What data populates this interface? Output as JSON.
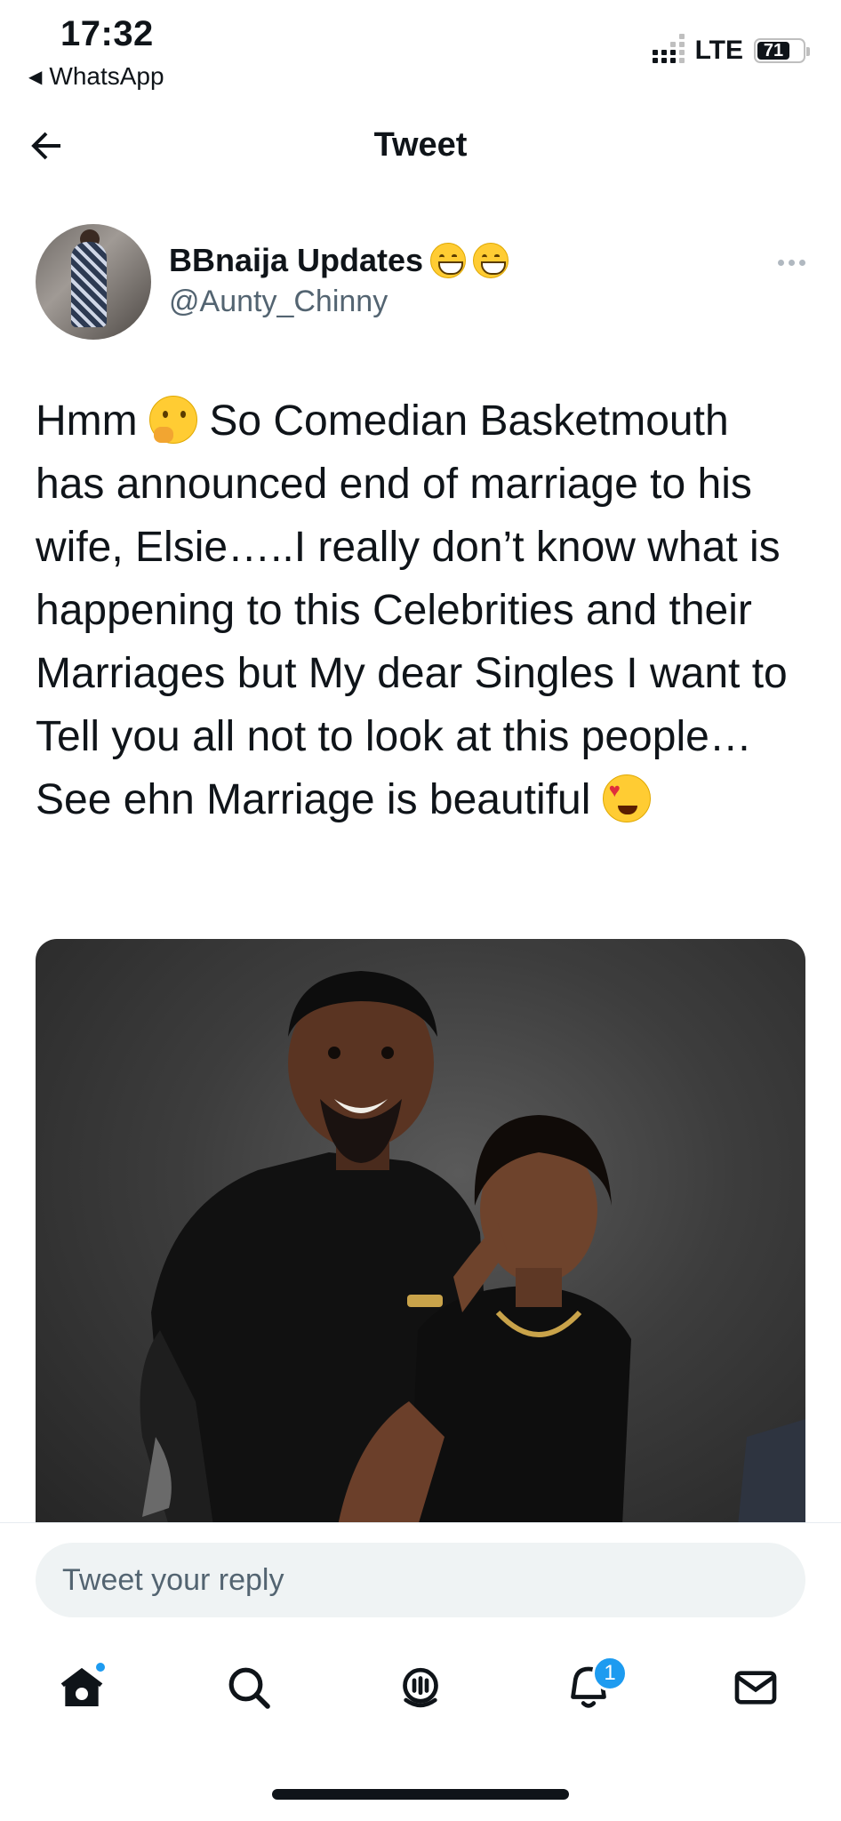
{
  "status_bar": {
    "time": "17:32",
    "back_app": "WhatsApp",
    "network": "LTE",
    "battery": "71"
  },
  "header": {
    "title": "Tweet"
  },
  "author": {
    "name": "BBnaija Updates",
    "handle": "@Aunty_Chinny"
  },
  "tweet": {
    "lines": [
      "Hmm",
      " So Comedian Basketmouth has announced end of marriage to his wife, Elsie…..I really don’t know what is happening to this Celebrities and their Marriages but My dear Singles I want to Tell you all not to look at this people…See ehn Marriage is beautiful"
    ]
  },
  "reply": {
    "placeholder": "Tweet your reply"
  },
  "tabs": {
    "home": "home-icon",
    "search": "search-icon",
    "spaces": "spaces-icon",
    "notifications": "bell-icon",
    "messages": "mail-icon",
    "notification_count": "1"
  },
  "colors": {
    "accent": "#1d9bf0",
    "text": "#0f1419",
    "secondary": "#536471"
  }
}
